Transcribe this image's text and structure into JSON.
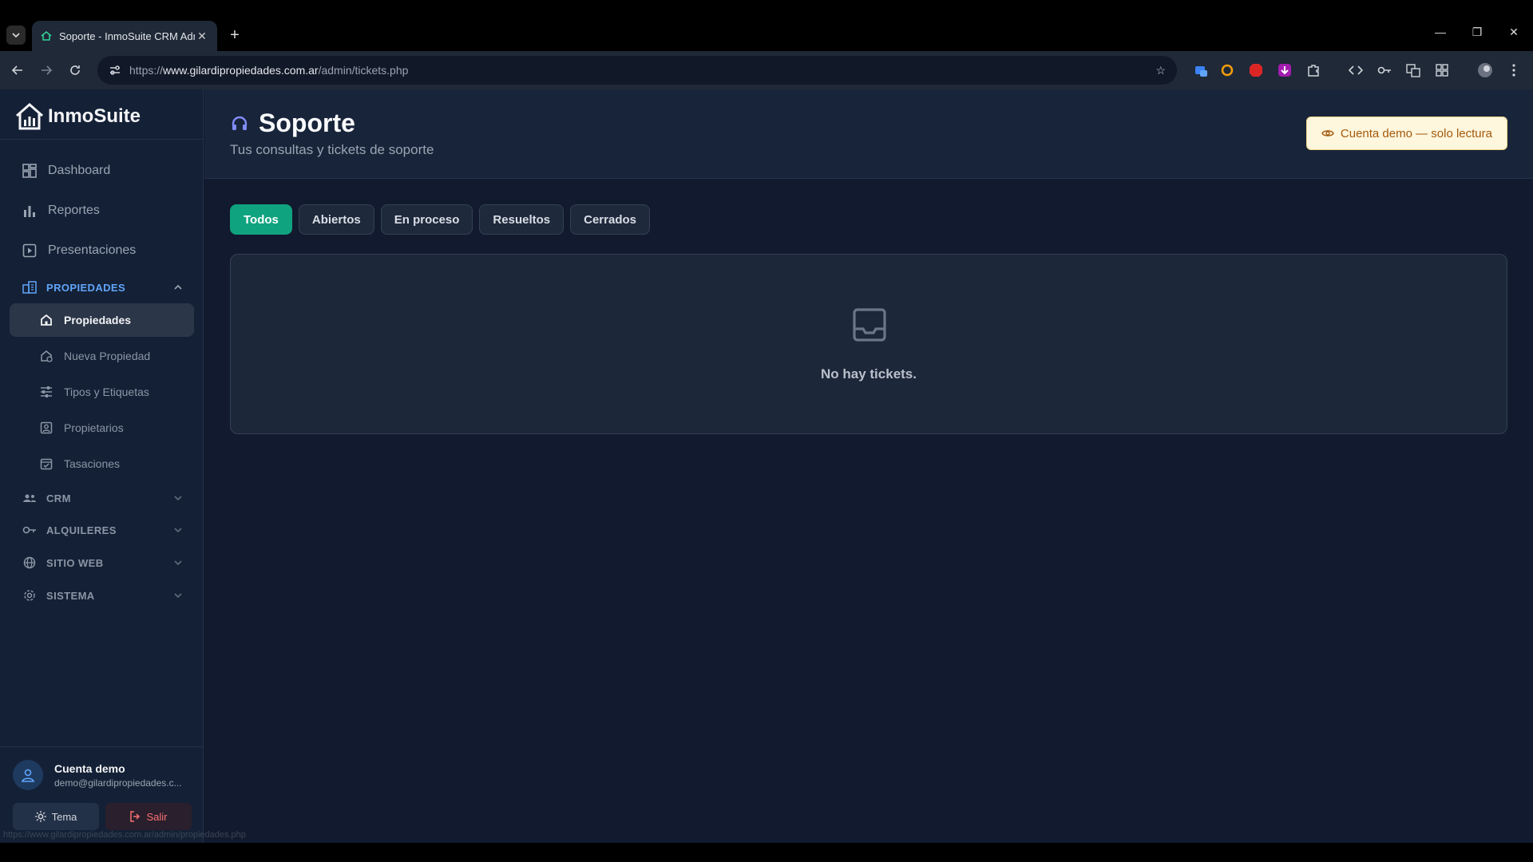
{
  "browser": {
    "tab_title": "Soporte - InmoSuite CRM Adm",
    "url_scheme": "https://",
    "url_host": "www.gilardipropiedades.com.ar",
    "url_path": "/admin/tickets.php"
  },
  "sidebar": {
    "brand": "InmoSuite",
    "main": [
      {
        "label": "Dashboard",
        "icon": "grid-icon"
      },
      {
        "label": "Reportes",
        "icon": "bar-chart-icon"
      },
      {
        "label": "Presentaciones",
        "icon": "play-square-icon"
      }
    ],
    "sections": {
      "propiedades": "PROPIEDADES",
      "crm": "CRM",
      "alquileres": "ALQUILERES",
      "sitio_web": "SITIO WEB",
      "sistema": "SISTEMA"
    },
    "propiedades_items": [
      {
        "label": "Propiedades"
      },
      {
        "label": "Nueva Propiedad"
      },
      {
        "label": "Tipos y Etiquetas"
      },
      {
        "label": "Propietarios"
      },
      {
        "label": "Tasaciones"
      }
    ],
    "user": {
      "name": "Cuenta demo",
      "email": "demo@gilardipropiedades.c..."
    },
    "theme_label": "Tema",
    "exit_label": "Salir",
    "status_url": "https://www.gilardipropiedades.com.ar/admin/propiedades.php"
  },
  "header": {
    "title": "Soporte",
    "subtitle": "Tus consultas y tickets de soporte",
    "demo_badge": "Cuenta demo — solo lectura"
  },
  "filters": [
    {
      "label": "Todos",
      "active": true
    },
    {
      "label": "Abiertos"
    },
    {
      "label": "En proceso"
    },
    {
      "label": "Resueltos"
    },
    {
      "label": "Cerrados"
    }
  ],
  "empty_state": {
    "message": "No hay tickets.",
    "icon": "inbox-icon"
  },
  "colors": {
    "accent": "#10a37f",
    "section_open": "#60a5fa",
    "badge_text": "#a35a0c"
  }
}
